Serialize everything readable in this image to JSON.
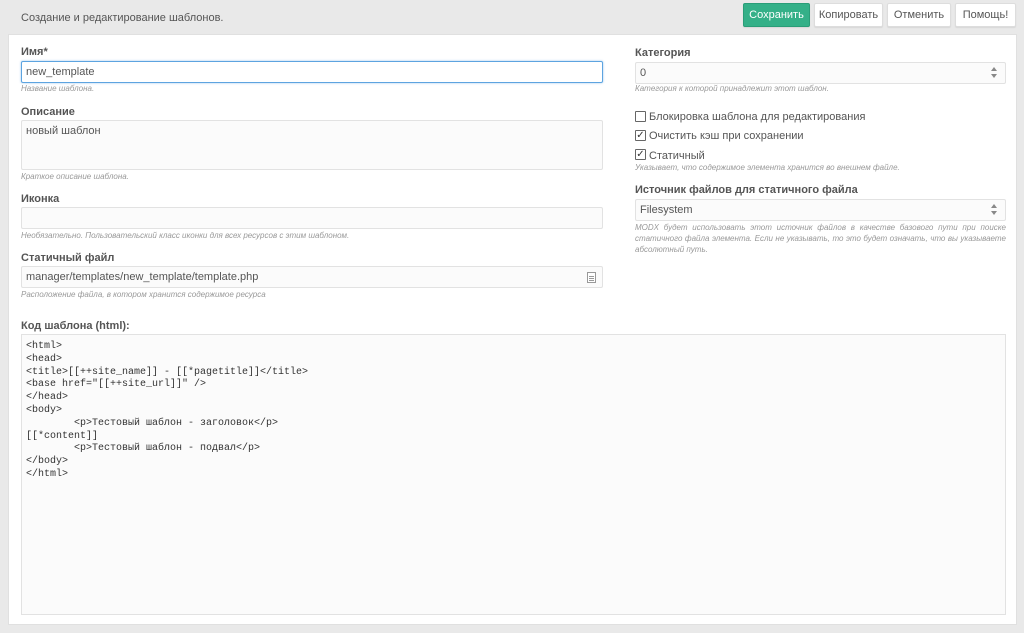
{
  "header": {
    "title": "Создание и редактирование шаблонов.",
    "buttons": {
      "save": "Сохранить",
      "copy": "Копировать",
      "cancel": "Отменить",
      "help": "Помощь!"
    }
  },
  "form": {
    "name": {
      "label": "Имя*",
      "value": "new_template",
      "hint": "Название шаблона."
    },
    "description": {
      "label": "Описание",
      "value": "новый шаблон",
      "hint": "Краткое описание шаблона."
    },
    "icon": {
      "label": "Иконка",
      "value": "",
      "hint": "Необязательно. Пользовательский класс иконки для всех ресурсов с этим шаблоном."
    },
    "static_file": {
      "label": "Статичный файл",
      "value": "manager/templates/new_template/template.php",
      "hint": "Расположение файла, в котором хранится содержимое ресурса"
    },
    "category": {
      "label": "Категория",
      "value": "0",
      "hint": "Категория к которой принадлежит этот шаблон."
    },
    "lock": {
      "label": "Блокировка шаблона для редактирования",
      "checked": false
    },
    "clear_cache": {
      "label": "Очистить кэш при сохранении",
      "checked": true
    },
    "static": {
      "label": "Статичный",
      "checked": true,
      "hint": "Указывает, что содержимое элемента хранится во внешнем файле."
    },
    "source": {
      "label": "Источник файлов для статичного файла",
      "value": "Filesystem",
      "hint": "MODX будет использовать этот источник файлов в качестве базового пути при поиске статичного файла элемента. Если не указывать, то это будет означать, что вы указываете абсолютный путь."
    },
    "code": {
      "label": "Код шаблона (html):",
      "value": "<html>\n<head>\n<title>[[++site_name]] - [[*pagetitle]]</title>\n<base href=\"[[++site_url]]\" />\n</head>\n<body>\n        <p>Тестовый шаблон - заголовок</p>\n[[*content]]\n        <p>Тестовый шаблон - подвал</p>\n</body>\n</html>"
    }
  },
  "colors": {
    "primary": "#34b088",
    "focus_border": "#5da4e0",
    "background": "#e9e9e9"
  }
}
